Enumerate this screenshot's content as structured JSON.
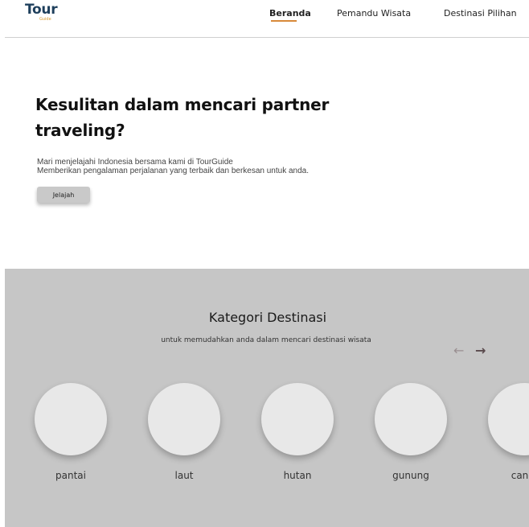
{
  "header": {
    "logo_main": "Tour",
    "logo_sub": "Guide",
    "nav": {
      "home": "Beranda",
      "guides": "Pemandu Wisata",
      "destinations": "Destinasi Pilihan"
    }
  },
  "hero": {
    "title": "Kesulitan dalam mencari partner traveling?",
    "desc_line1": "Mari menjelajahi Indonesia bersama kami di TourGuide",
    "desc_line2": "Memberikan pengalaman perjalanan yang terbaik dan berkesan untuk anda.",
    "button_label": "Jelajah"
  },
  "categories": {
    "title": "Kategori Destinasi",
    "subtitle": "untuk memudahkan anda dalam mencari destinasi wisata",
    "arrow_left": "←",
    "arrow_right": "→",
    "items": [
      {
        "label": "pantai"
      },
      {
        "label": "laut"
      },
      {
        "label": "hutan"
      },
      {
        "label": "gunung"
      },
      {
        "label": "candi"
      }
    ]
  },
  "colors": {
    "logo": "#1e3f5c",
    "logo_accent": "#d79a2e",
    "nav_active_underline": "#d8893a",
    "section_bg": "#c6c6c6",
    "circle": "#e8e8e8",
    "button": "#c9c9c9"
  }
}
